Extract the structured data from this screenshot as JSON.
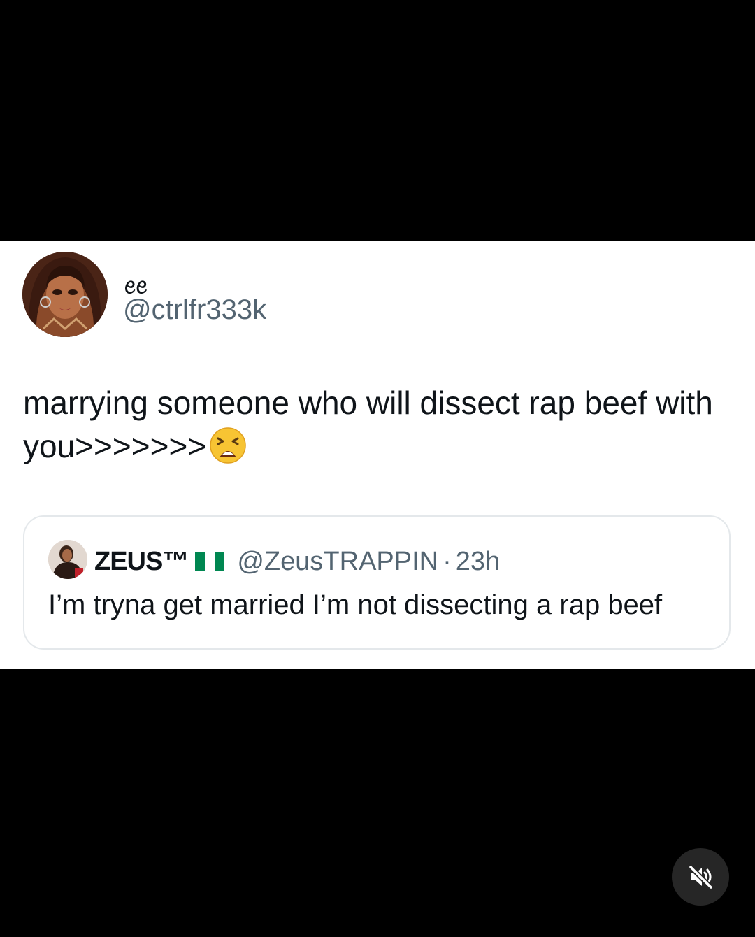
{
  "tweet": {
    "display_name": "ꫀꫀ",
    "handle": "@ctrlfr333k",
    "text": "marrying someone who will dissect rap beef with you>>>>>>>",
    "emoji": "tired-face-emoji"
  },
  "quote": {
    "display_name": "ZEUS™",
    "flag": "nigeria-flag",
    "handle": "@ZeusTRAPPIN",
    "separator": "·",
    "time": "23h",
    "text": "I’m tryna get married I’m not dissecting a rap beef"
  },
  "controls": {
    "mute_icon": "speaker-muted-icon"
  },
  "colors": {
    "background": "#000000",
    "card": "#ffffff",
    "text_primary": "#0f1419",
    "text_secondary": "#536471",
    "border": "#e4e8eb",
    "flag_green": "#008751"
  }
}
